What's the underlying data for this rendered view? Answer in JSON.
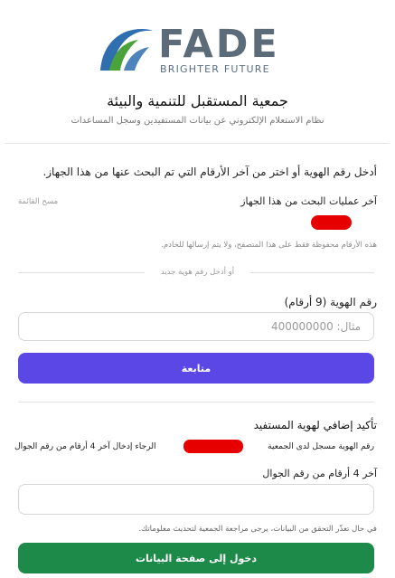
{
  "brand": {
    "name": "FADE",
    "tagline": "BRIGHTER FUTURE",
    "colors": {
      "word": "#5c6b78",
      "blue": "#2f6fb0",
      "green": "#4aa33a"
    }
  },
  "header": {
    "title": "جمعية المستقبل للتنمية والبيئة",
    "subtitle": "نظام الاستعلام الإلكتروني عن بيانات المستفيدين وسجل المساعدات"
  },
  "lookup": {
    "instruction": "أدخل رقم الهوية أو اختر من آخر الأرقام التي تم البحث عنها من هذا الجهاز.",
    "recent_title": "آخر عمليات البحث من هذا الجهاز",
    "clear_label": "مسح القائمة",
    "privacy_note": "هذه الأرقام محفوظة فقط على هذا المتصفح، ولا يتم إرسالها للخادم.",
    "divider_text": "أو أدخل رقم هوية جديد",
    "id_label": "رقم الهوية (9 أرقام)",
    "id_placeholder": "مثال: 400000000",
    "id_value": "",
    "continue_label": "متابعة"
  },
  "confirm": {
    "title": "تأكيد إضافي لهوية المستفيد",
    "text_start": "رقم الهوية مسجل لدى الجمعية",
    "text_end": "الرجاء إدخال آخر 4 أرقام من رقم الجوال",
    "phone_label": "آخر 4 أرقام من رقم الجوال",
    "phone_value": "",
    "note": "في حال تعذّر التحقق من البيانات، يرجى مراجعة الجمعية لتحديث معلوماتك.",
    "submit_label": "دخول إلى صفحة البيانات"
  },
  "colors": {
    "primary_button": "#5b47e6",
    "success_button": "#1e8a4a",
    "redaction": "#e60000"
  }
}
